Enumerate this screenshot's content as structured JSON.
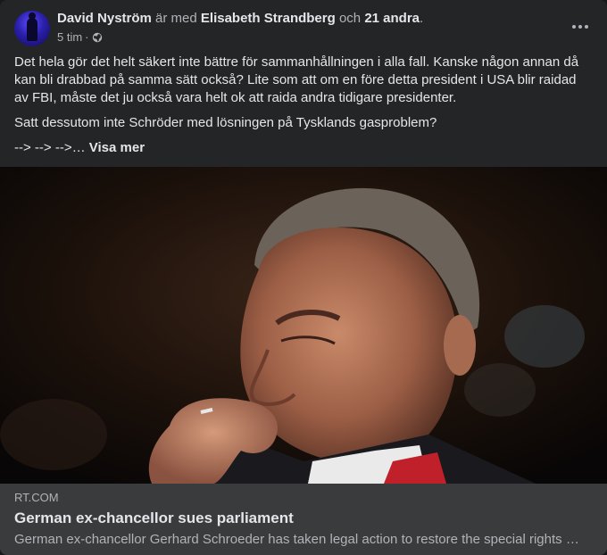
{
  "post": {
    "author": "David Nyström",
    "with_text": "är med",
    "tagged_person": "Elisabeth Strandberg",
    "and_text": "och",
    "others": "21 andra",
    "period": ".",
    "time": "5 tim",
    "separator": "·",
    "paragraphs": [
      "Det hela gör det helt säkert inte bättre för sammanhållningen i alla fall. Kanske någon annan då kan bli drabbad på samma sätt också? Lite som att om en före detta president i USA blir raidad av FBI, måste det ju också vara helt ok att raida andra tidigare presidenter.",
      "Satt dessutom inte Schröder med lösningen på Tysklands gasproblem?"
    ],
    "arrows": "--> --> -->…",
    "see_more": "Visa mer"
  },
  "link": {
    "domain": "RT.COM",
    "title": "German ex-chancellor sues parliament",
    "description": "German ex-chancellor Gerhard Schroeder has taken legal action to restore the special rights of his office"
  },
  "colors": {
    "card_bg": "#242526",
    "link_bg": "#3a3b3c",
    "text_primary": "#e4e6eb",
    "text_secondary": "#b0b3b8"
  },
  "icons": {
    "globe": "globe-icon",
    "more": "more-options-icon"
  }
}
